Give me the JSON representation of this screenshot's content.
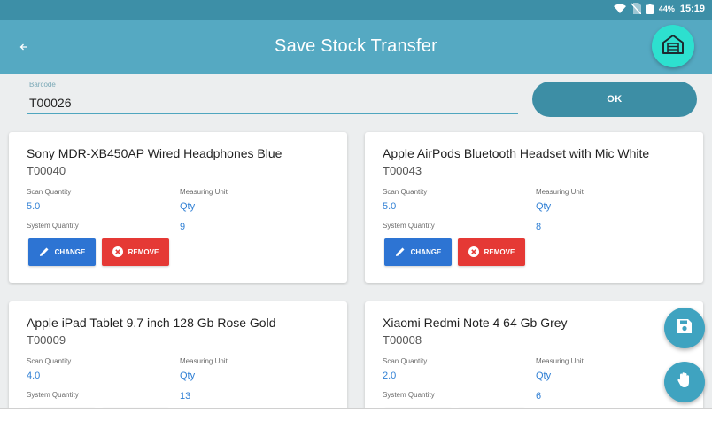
{
  "status_bar": {
    "battery": "44%",
    "time": "15:19"
  },
  "app_bar": {
    "title": "Save Stock Transfer",
    "back_icon": "back-arrow-icon",
    "action_icon": "garage-icon"
  },
  "barcode": {
    "label": "Barcode",
    "value": "T00026"
  },
  "ok_button": {
    "label": "OK"
  },
  "field_labels": {
    "scan_quantity": "Scan Quantity",
    "measuring_unit": "Measuring Unit",
    "system_quantity": "System Quantity"
  },
  "buttons": {
    "change": "CHANGE",
    "remove": "REMOVE"
  },
  "items": [
    {
      "name": "Sony MDR-XB450AP Wired Headphones Blue",
      "code": "T00040",
      "scan_quantity": "5.0",
      "measuring_unit": "Qty",
      "system_quantity": "9"
    },
    {
      "name": "Apple AirPods Bluetooth Headset with Mic White",
      "code": "T00043",
      "scan_quantity": "5.0",
      "measuring_unit": "Qty",
      "system_quantity": "8"
    },
    {
      "name": "Apple iPad Tablet 9.7 inch 128 Gb Rose Gold",
      "code": "T00009",
      "scan_quantity": "4.0",
      "measuring_unit": "Qty",
      "system_quantity": "13"
    },
    {
      "name": "Xiaomi Redmi Note 4 64 Gb Grey",
      "code": "T00008",
      "scan_quantity": "2.0",
      "measuring_unit": "Qty",
      "system_quantity": "6"
    }
  ],
  "fabs": {
    "save_icon": "save-icon",
    "hand_icon": "hand-icon"
  },
  "colors": {
    "app_bar": "#55a9c2",
    "status_bar": "#3d8fa7",
    "accent": "#2de0cf",
    "change": "#2d74d3",
    "remove": "#e53935",
    "value_text": "#2f7fd4"
  }
}
